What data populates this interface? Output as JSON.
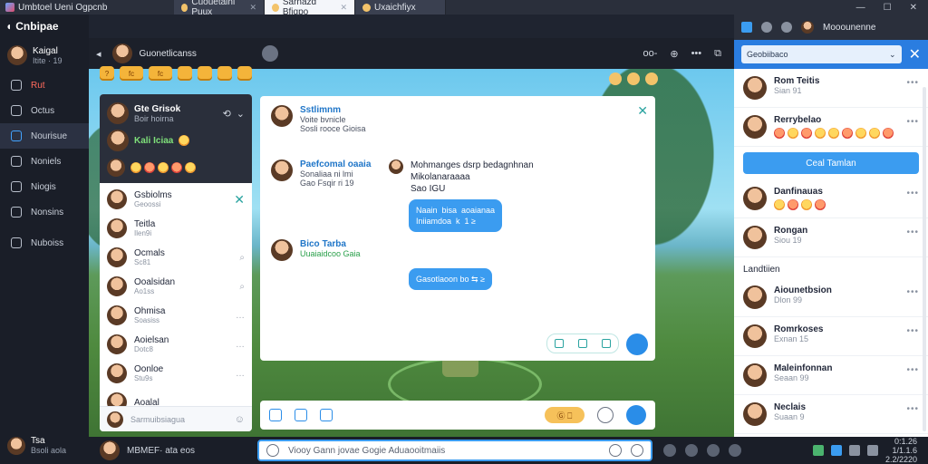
{
  "titlebar": {
    "app_name": "Umbtoel  Ueni Ogpcnb",
    "tabs": [
      {
        "label": "Cuouetaini  Puux",
        "active": false
      },
      {
        "label": "Sarnazd Bfiqpo",
        "active": true
      },
      {
        "label": "Uxaichfiyx",
        "active": false
      }
    ],
    "controls": [
      "—",
      "☐",
      "✕"
    ]
  },
  "sidebar": {
    "brand": "Cnbipae",
    "user": {
      "name": "Kaigal",
      "sub": "Itite · 19"
    },
    "items": [
      {
        "label": "Rut",
        "icon": "inbox-icon",
        "style": "red"
      },
      {
        "label": "Octus",
        "icon": "camera-icon",
        "style": ""
      },
      {
        "label": "Nourisue",
        "icon": "grid-icon",
        "style": "active"
      },
      {
        "label": "Noniels",
        "icon": "home-icon",
        "style": ""
      },
      {
        "label": "Niogis",
        "icon": "pin-icon",
        "style": ""
      },
      {
        "label": "Nonsins",
        "icon": "tool-icon",
        "style": ""
      },
      {
        "label": "Nuboiss",
        "icon": "mail-icon",
        "style": ""
      }
    ],
    "footer": {
      "name": "Tsa",
      "sub": "Bsoli aola"
    }
  },
  "topbar": {
    "title": "Guonetlicanss",
    "right": [
      "oo-",
      "⊕",
      "•••",
      "⧉"
    ]
  },
  "right_top": {
    "name": "Mooounenne"
  },
  "topstrip": [
    "?",
    "fc",
    "fc",
    "",
    "",
    "",
    ""
  ],
  "convs": {
    "header": [
      {
        "name": "Gte Grisok",
        "sub": "Boir hoirna",
        "icon": "⟲"
      },
      {
        "name": "Kali Iciaa",
        "sub": ""
      }
    ],
    "items": [
      {
        "name": "Gsbiolms",
        "sub": "Geoossi",
        "action": "✕"
      },
      {
        "name": "Teitla",
        "sub": "Ilen9i",
        "action": ""
      },
      {
        "name": "Ocmals",
        "sub": "Sc81",
        "action": "⌕"
      },
      {
        "name": "Ooalsidan",
        "sub": "Ao1ss",
        "action": "⌕"
      },
      {
        "name": "Ohmisa",
        "sub": "Soasiss",
        "action": "…"
      },
      {
        "name": "Aoielsan",
        "sub": "Dotc8",
        "action": "…"
      },
      {
        "name": "Oonloe",
        "sub": "Stu9s",
        "action": "…"
      },
      {
        "name": "Aoalal",
        "sub": "",
        "action": ""
      }
    ],
    "search_placeholder": "Sarmuibsiagua"
  },
  "chat": {
    "blocks": [
      {
        "name": "Sstlimnm",
        "lines": [
          "Voite bvnicle",
          "Sosli  rooce  Gioisa"
        ]
      },
      {
        "name": "Paefcomal  oaaia",
        "lines": [
          "Sonaliaa  ni  lmi",
          "Gao Fsqir  ri  19"
        ]
      },
      {
        "name": "Bico Tarba",
        "lines": [
          "Uuaiaidcoo  Gaia"
        ]
      }
    ],
    "inline_message": [
      "Mohmanges  dsrp bedagnhnan",
      "Mikolanaraaaa",
      "Sao IGU"
    ],
    "bubbles": [
      "Naain  bisa  aoaianaa\nIniiamdoa  k  1 ≥",
      "Gasotlaoon bo ⇆ ≥"
    ]
  },
  "compose": {
    "gold_label": "Ⓖ ⎕"
  },
  "bottombar": {
    "user_name": "MBMEF· ata eos",
    "input_placeholder": "Viooy  Gann  jovae  Gogie  Aduaooitmaiis",
    "time": [
      "0:1.26",
      "1/1.1.6",
      "2.2/2220"
    ]
  },
  "right_panel": {
    "search": "Geobiibaco",
    "top_items": [
      {
        "name": "Rom Teitis",
        "sub": "Sian 91",
        "emojis": 0
      },
      {
        "name": "Rerrybelao",
        "sub": "",
        "emojis": 9
      },
      {
        "name": "Danfinauas",
        "sub": "",
        "emojis": 4
      },
      {
        "name": "Rongan",
        "sub": "Siou 19",
        "emojis": 0
      }
    ],
    "button": "Ceal Tamlan",
    "section": "Landtiien",
    "bottom_items": [
      {
        "name": "Aiounetbsion",
        "sub": "Dlon 99"
      },
      {
        "name": "Romrkoses",
        "sub": "Exnan 15"
      },
      {
        "name": "Maleinfonnan",
        "sub": "Seaan 99"
      },
      {
        "name": "Neclais",
        "sub": "Suaan 9"
      }
    ]
  }
}
